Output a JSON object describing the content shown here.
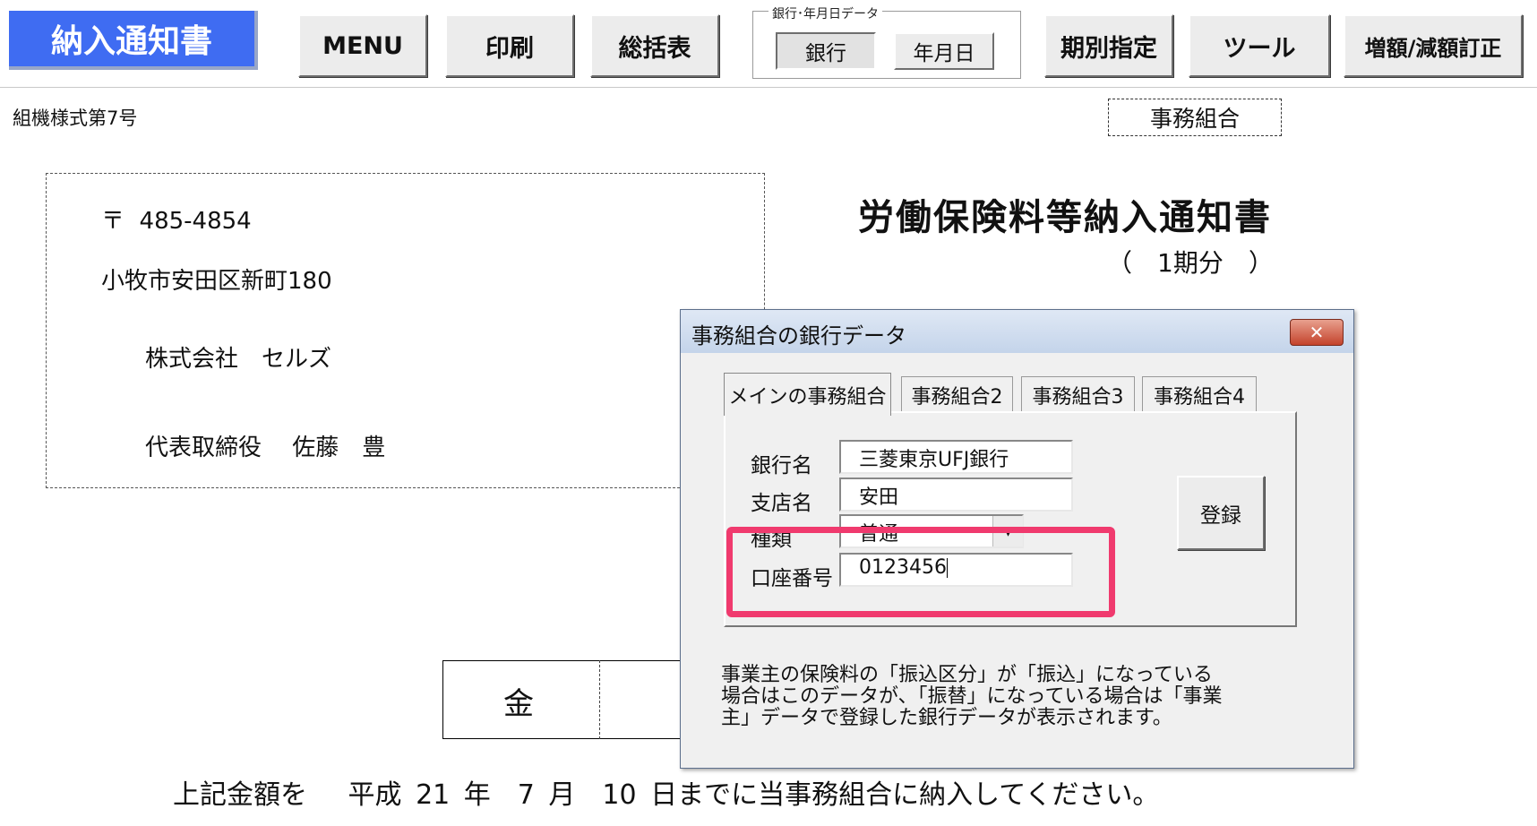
{
  "toolbar": {
    "title": "納入通知書",
    "menu": "MENU",
    "print": "印刷",
    "summary": "総括表",
    "bank_date_group": "銀行･年月日データ",
    "bank": "銀行",
    "date": "年月日",
    "period_select": "期別指定",
    "tools": "ツール",
    "correction": "増額/減額訂正"
  },
  "document": {
    "form_number": "組機様式第7号",
    "office_label": "事務組合",
    "postal_mark": "〒",
    "postal_code": "485-4854",
    "address": "小牧市安田区新町180",
    "company": "株式会社　セルズ",
    "representative": "代表取締役　 佐藤　豊",
    "title": "労働保険料等納入通知書",
    "period": "（　1期分　）",
    "amount_label": "金",
    "deadline_text": "上記金額を　 平成 21 年　7 月　10 日までに当事務組合に納入してください。"
  },
  "dialog": {
    "title": "事務組合の銀行データ",
    "close": "✕",
    "tabs": [
      "メインの事務組合",
      "事務組合2",
      "事務組合3",
      "事務組合4"
    ],
    "fields": {
      "bank_name_label": "銀行名",
      "bank_name": "三菱東京UFJ銀行",
      "branch_label": "支店名",
      "branch": "安田",
      "type_label": "種類",
      "type": "普通",
      "account_label": "口座番号",
      "account": "0123456"
    },
    "register": "登録",
    "note": "事業主の保険料の「振込区分」が「振込」になっている場合はこのデータが、「振替」になっている場合は「事業主」データで登録した銀行データが表示されます。"
  },
  "colors": {
    "title_button": "#3f6cf2",
    "highlight": "#f03a6e"
  }
}
